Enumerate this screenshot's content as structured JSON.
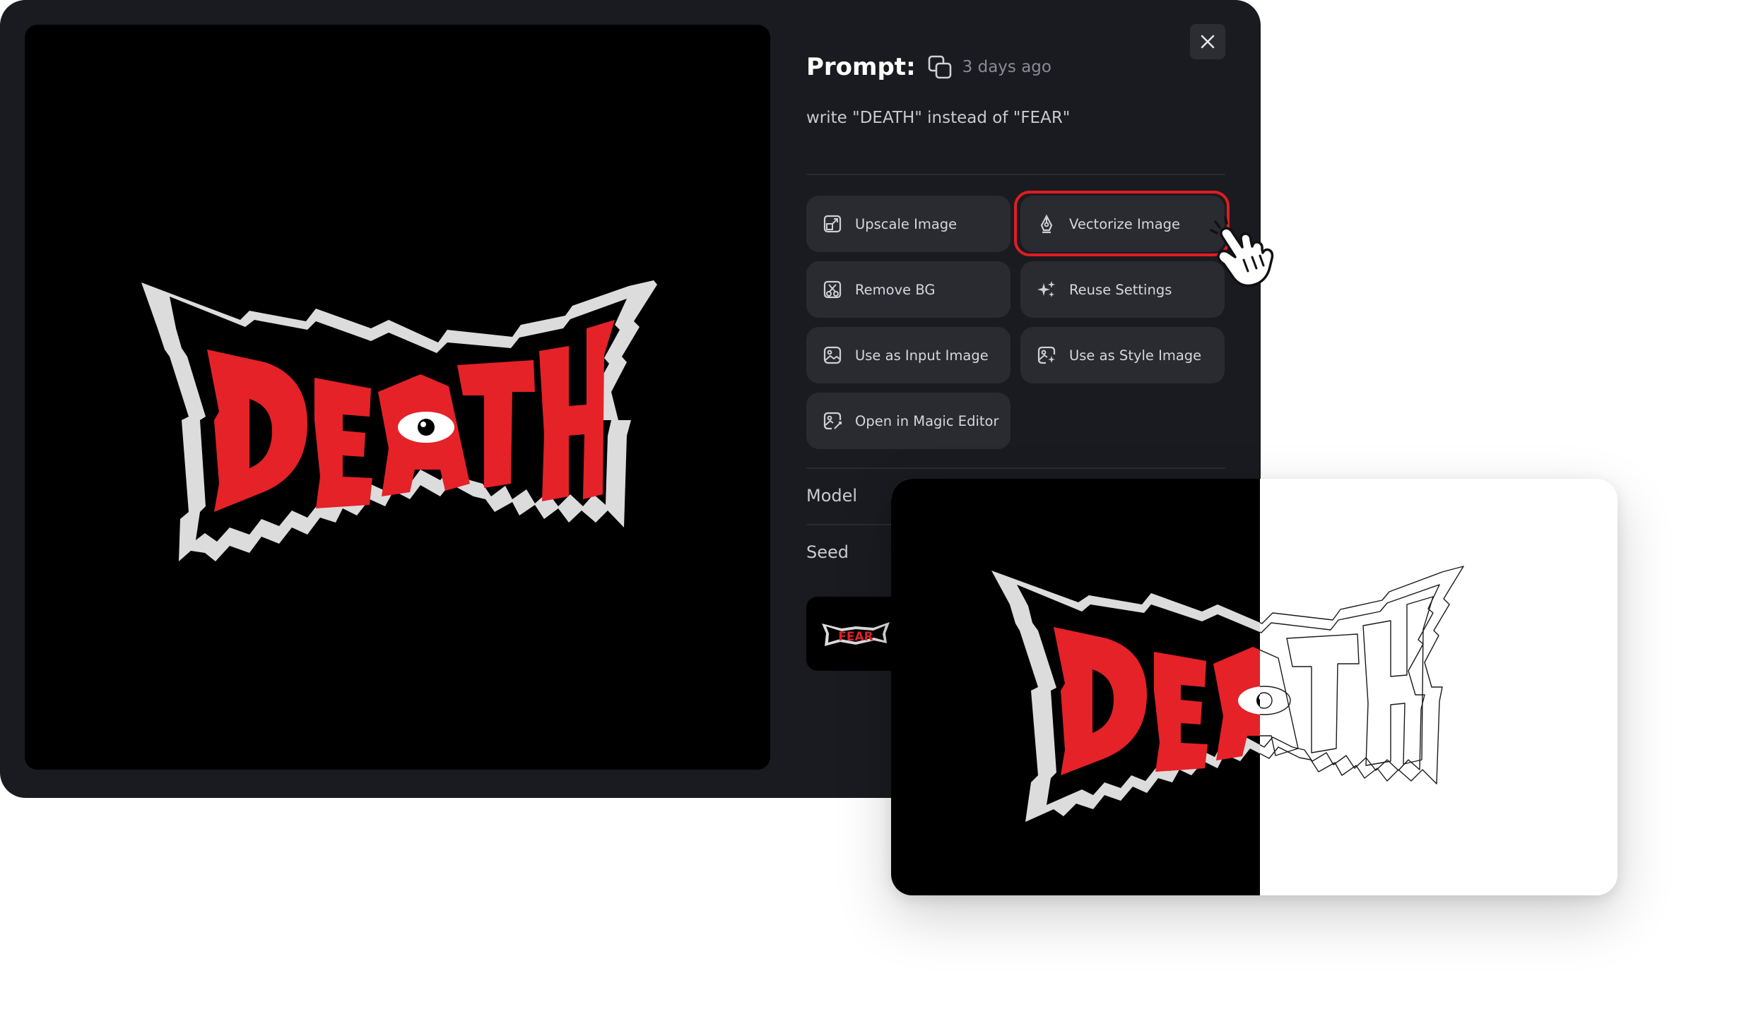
{
  "header": {
    "prompt_label": "Prompt:",
    "time_ago": "3 days ago"
  },
  "prompt_text": "write \"DEATH\" instead of \"FEAR\"",
  "actions": [
    {
      "label": "Upscale Image",
      "icon": "upscale-icon"
    },
    {
      "label": "Vectorize Image",
      "icon": "pen-nib-icon",
      "highlighted": true
    },
    {
      "label": "Remove BG",
      "icon": "remove-bg-icon"
    },
    {
      "label": "Reuse Settings",
      "icon": "sparkles-icon"
    },
    {
      "label": "Use as Input Image",
      "icon": "image-icon"
    },
    {
      "label": "Use as Style Image",
      "icon": "style-image-icon"
    },
    {
      "label": "Open in Magic Editor",
      "icon": "magic-editor-icon"
    }
  ],
  "info": {
    "model_label": "Model",
    "seed_label": "Seed"
  },
  "main_image": {
    "logo_text": "DEATH",
    "colors": {
      "red": "#e42228",
      "outline": "#dcdcdc",
      "background": "#000000"
    }
  },
  "history_thumb": {
    "text": "FEAR"
  },
  "compare_card": {
    "logo_text": "DEATH",
    "left_half": "raster",
    "right_half": "vector outline"
  },
  "colors": {
    "modal_bg": "#1a1b20",
    "button_bg": "#2a2b31",
    "highlight": "#e01d22"
  }
}
